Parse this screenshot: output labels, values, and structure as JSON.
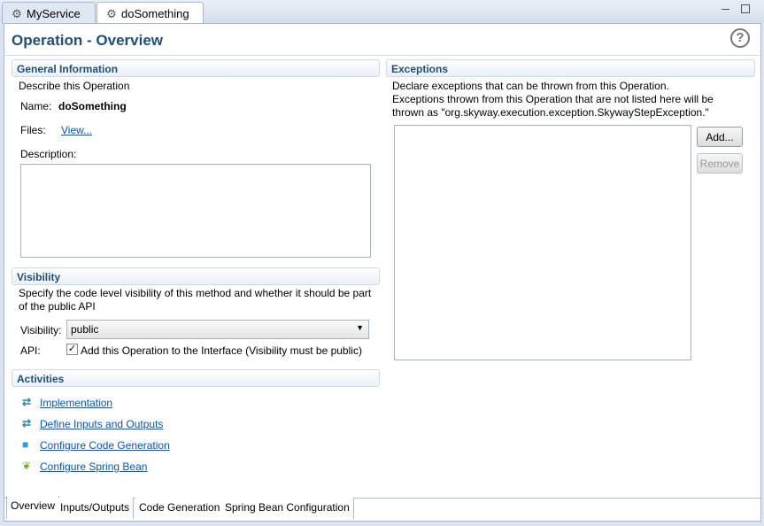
{
  "tabs": [
    {
      "label": "MyService",
      "icon": "gear-icon"
    },
    {
      "label": "doSomething",
      "icon": "gears-icon",
      "close": "✕"
    }
  ],
  "header": {
    "title": "Operation - Overview",
    "help": "?"
  },
  "general": {
    "heading": "General Information",
    "desc": "Describe this Operation",
    "name_label": "Name:",
    "name_value": "doSomething",
    "files_label": "Files:",
    "files_link": "View...",
    "description_label": "Description:",
    "description_value": ""
  },
  "visibility": {
    "heading": "Visibility",
    "desc": "Specify the code level visibility of this method and whether it should be part of the public API",
    "visibility_label": "Visibility:",
    "visibility_value": "public",
    "api_label": "API:",
    "api_checkbox": "Add this Operation to the Interface (Visibility must be public)",
    "api_checked": true
  },
  "activities": {
    "heading": "Activities",
    "items": [
      {
        "label": "Implementation",
        "icon": "arrows-icon"
      },
      {
        "label": "Define Inputs and Outputs",
        "icon": "arrows-icon"
      },
      {
        "label": "Configure Code Generation",
        "icon": "cube-gear-icon"
      },
      {
        "label": "Configure Spring Bean",
        "icon": "spring-bean-icon"
      }
    ]
  },
  "exceptions": {
    "heading": "Exceptions",
    "desc1": "Declare exceptions that can be thrown from this Operation.",
    "desc2": "Exceptions thrown from this Operation that are not listed here will be",
    "desc3": "thrown as \"org.skyway.execution.exception.SkywayStepException.\"",
    "add": "Add...",
    "remove": "Remove"
  },
  "bottom_tabs": [
    "Overview",
    "Inputs/Outputs",
    "Code Generation",
    "Spring Bean Configuration"
  ]
}
